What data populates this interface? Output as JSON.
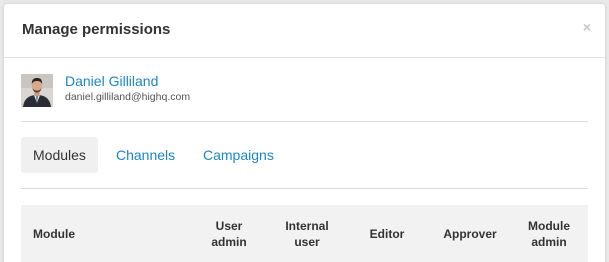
{
  "dialog": {
    "title": "Manage permissions",
    "close_glyph": "×"
  },
  "user": {
    "name": "Daniel Gilliland",
    "email": "daniel.gilliland@highq.com"
  },
  "tabs": [
    {
      "label": "Modules",
      "active": true
    },
    {
      "label": "Channels",
      "active": false
    },
    {
      "label": "Campaigns",
      "active": false
    }
  ],
  "table": {
    "columns": [
      {
        "line1": "Module",
        "line2": ""
      },
      {
        "line1": "User",
        "line2": "admin"
      },
      {
        "line1": "Internal",
        "line2": "user"
      },
      {
        "line1": "Editor",
        "line2": ""
      },
      {
        "line1": "Approver",
        "line2": ""
      },
      {
        "line1": "Module",
        "line2": "admin"
      }
    ]
  },
  "colors": {
    "link": "#1b86c9",
    "header_bg": "#f2f2f2",
    "active_tab_bg": "#f0f0f0"
  }
}
